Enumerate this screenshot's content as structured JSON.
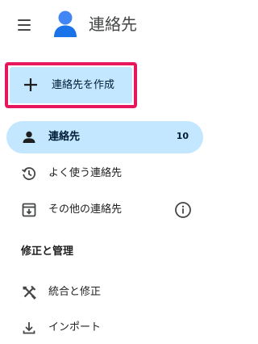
{
  "header": {
    "menu_icon": "hamburger-menu-icon",
    "logo_icon": "contacts-person-logo",
    "title": "連絡先"
  },
  "create": {
    "icon": "plus-icon",
    "label": "連絡先を作成"
  },
  "nav": {
    "items": [
      {
        "icon": "person-icon",
        "label": "連絡先",
        "count": "10"
      },
      {
        "icon": "history-icon",
        "label": "よく使う連絡先"
      },
      {
        "icon": "archive-download-icon",
        "label": "その他の連絡先",
        "trailing_icon": "info-icon"
      }
    ]
  },
  "section": {
    "title": "修正と管理",
    "items": [
      {
        "icon": "merge-fix-tools-icon",
        "label": "統合と修正"
      },
      {
        "icon": "import-icon",
        "label": "インポート"
      }
    ]
  },
  "colors": {
    "accent_bg": "#c2e7ff",
    "highlight_border": "#e8175d",
    "logo_blue": "#1a73e8",
    "icon_gray": "#444746"
  }
}
